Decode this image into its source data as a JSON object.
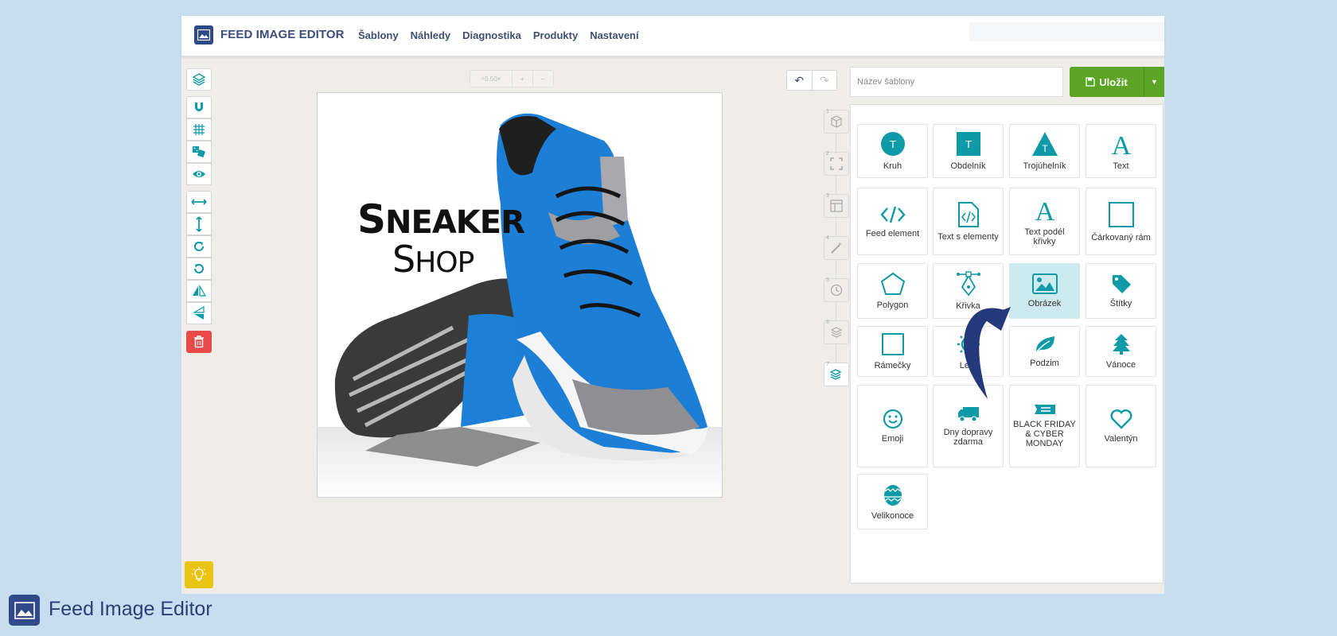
{
  "app": {
    "title": "FEED IMAGE EDITOR",
    "nav": [
      "Šablony",
      "Náhledy",
      "Diagnostika",
      "Produkty",
      "Nastavení"
    ]
  },
  "toolbar": {
    "tools": [
      "layers-icon",
      "magnet-icon",
      "grid-icon",
      "dice-icon",
      "eye-icon",
      "stretch-horizontal-icon",
      "stretch-vertical-icon",
      "rotate-right-icon",
      "rotate-left-icon",
      "flip-horizontal-icon",
      "flip-vertical-icon"
    ],
    "delete_icon": "trash-icon"
  },
  "zoom": {
    "label": "0.50×",
    "plus": "+",
    "minus": "−"
  },
  "canvas": {
    "brand_line1_big": "S",
    "brand_line1_rest": "NEAKER",
    "brand_line2_big": "S",
    "brand_line2_rest": "HOP"
  },
  "history": {
    "undo": "↶",
    "redo": "↷"
  },
  "steps": [
    "1",
    "2",
    "3",
    "4",
    "5",
    "6",
    "7"
  ],
  "template_name": {
    "placeholder": "Název šablony"
  },
  "save": {
    "label": "Uložit"
  },
  "elements": [
    {
      "label": "Kruh",
      "icon": "circle-t-icon"
    },
    {
      "label": "Obdelník",
      "icon": "rectangle-t-icon"
    },
    {
      "label": "Trojúhelník",
      "icon": "triangle-t-icon"
    },
    {
      "label": "Text",
      "icon": "text-a-icon"
    },
    {
      "label": "Feed element",
      "icon": "code-icon"
    },
    {
      "label": "Text s elementy",
      "icon": "code-file-icon"
    },
    {
      "label": "Text podél křivky",
      "icon": "text-curve-icon"
    },
    {
      "label": "Čárkovaný rám",
      "icon": "dashed-frame-icon"
    },
    {
      "label": "Polygon",
      "icon": "pentagon-icon"
    },
    {
      "label": "Křivka",
      "icon": "pen-curve-icon"
    },
    {
      "label": "Obrázek",
      "icon": "image-icon"
    },
    {
      "label": "Štítky",
      "icon": "tag-icon"
    },
    {
      "label": "Rámečky",
      "icon": "frame-icon"
    },
    {
      "label": "Léto",
      "icon": "sun-icon"
    },
    {
      "label": "Podzim",
      "icon": "leaf-icon"
    },
    {
      "label": "Vánoce",
      "icon": "tree-icon"
    },
    {
      "label": "Emoji",
      "icon": "smile-icon"
    },
    {
      "label": "Dny dopravy zdarma",
      "icon": "truck-icon"
    },
    {
      "label": "BLACK FRIDAY & CYBER MONDAY",
      "icon": "black-friday-icon"
    },
    {
      "label": "Valentýn",
      "icon": "heart-icon"
    },
    {
      "label": "Velikonoce",
      "icon": "easter-egg-icon"
    }
  ],
  "footer": {
    "title": "Feed Image Editor"
  },
  "colors": {
    "teal": "#0e9aa7",
    "navy": "#2f4a86",
    "green": "#5ca425",
    "red": "#e84a4a",
    "yellow": "#e9c414"
  }
}
